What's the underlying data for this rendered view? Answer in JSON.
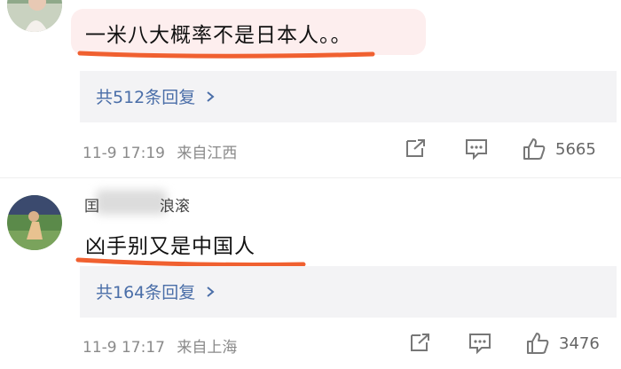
{
  "comments": [
    {
      "text": "一米八大概率不是日本人。。",
      "reply_label": "共512条回复",
      "date": "11-9 17:19",
      "location": "来自江西",
      "likes": "5665",
      "highlight_color": "#fdeeee",
      "underline_color": "#f06030"
    },
    {
      "username": "囯　　　　浪滚",
      "text": "凶手别又是中国人",
      "reply_label": "共164条回复",
      "date": "11-9 17:17",
      "location": "来自上海",
      "likes": "3476",
      "underline_color": "#f06030"
    }
  ],
  "icons": [
    "share-icon",
    "comment-icon",
    "like-icon"
  ],
  "colors": {
    "link": "#4a6ea8",
    "meta": "#8a8a8a"
  }
}
